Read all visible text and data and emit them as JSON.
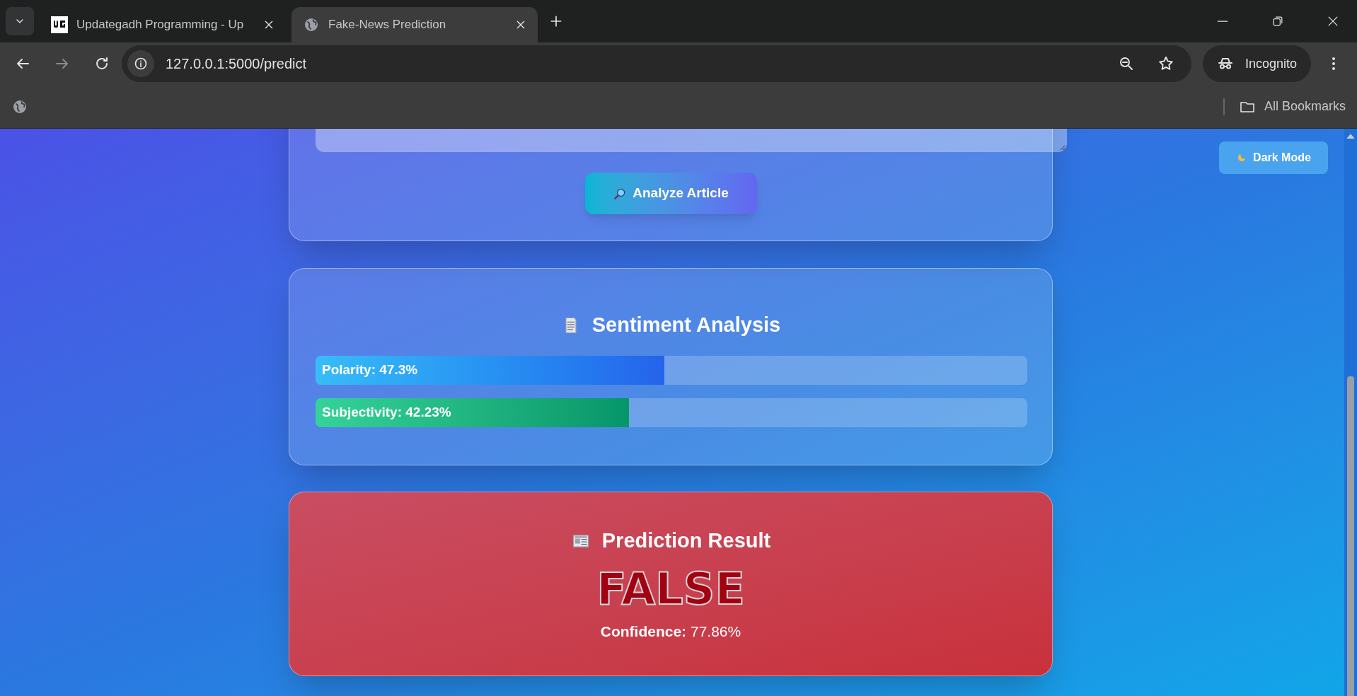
{
  "browser": {
    "tabs": [
      {
        "title": "Updategadh Programming - Up",
        "selected": false,
        "kind": "logo"
      },
      {
        "title": "Fake-News Prediction",
        "selected": true,
        "kind": "globe"
      }
    ],
    "address": "127.0.0.1:5000/predict",
    "profile": "Incognito",
    "bookmarks_label": "All Bookmarks"
  },
  "page": {
    "theme_button": "Dark Mode",
    "analyze_button": "Analyze Article",
    "sentiment": {
      "title": "Sentiment Analysis",
      "meters": [
        {
          "label": "Polarity: 47.3%",
          "level": 0.49,
          "kind": "polarity"
        },
        {
          "label": "Subjectivity: 42.23%",
          "level": 0.44,
          "kind": "subjectivity"
        }
      ]
    },
    "result": {
      "title": "Prediction Result",
      "verdict": "FALSE",
      "fake": true,
      "confidence_label": "Confidence:",
      "confidence_value": "77.86%"
    }
  }
}
